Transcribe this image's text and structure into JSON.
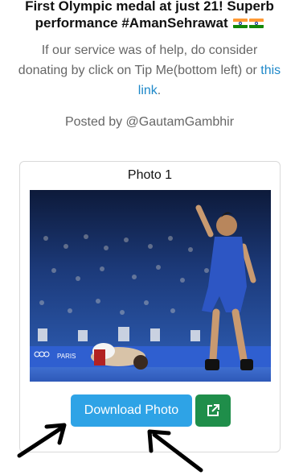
{
  "tweet": {
    "text": "First Olympic medal at just 21! Superb performance #AmanSehrawat"
  },
  "service_message": {
    "text": "If our service was of help, do consider donating by click on Tip Me(bottom left) or",
    "link_text": "this link",
    "suffix": "."
  },
  "posted_by": "Posted by @GautamGambhir",
  "card": {
    "title": "Photo 1",
    "download_label": "Download Photo",
    "open_icon": "external-link-icon"
  },
  "photo": {
    "banner_text": "PARIS"
  },
  "colors": {
    "download_button": "#2ea3e6",
    "open_button": "#1f8e4a",
    "link": "#1e88c9",
    "muted_text": "#666666"
  }
}
